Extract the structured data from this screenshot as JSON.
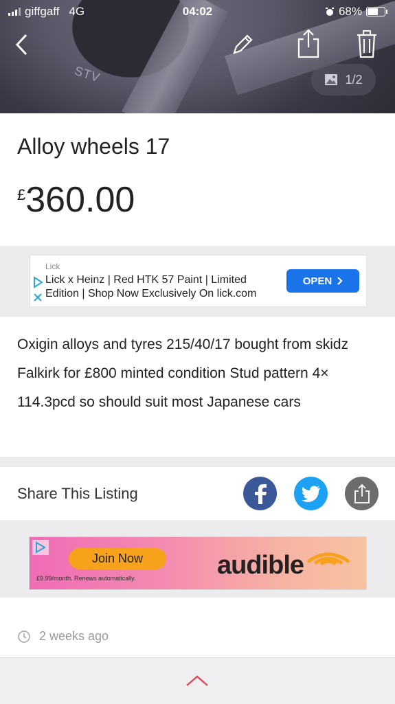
{
  "status_bar": {
    "carrier": "giffgaff",
    "network": "4G",
    "time": "04:02",
    "battery": "68%",
    "battery_level": 0.68
  },
  "header": {
    "photo_counter": "1/2",
    "rim_text": "STV"
  },
  "listing": {
    "title": "Alloy wheels 17",
    "currency": "£",
    "price": "360.00",
    "description": "Oxigin alloys and tyres 215/40/17 bought from skidz Falkirk for £800 minted condition Stud pattern 4× 114.3pcd so should suit most Japanese cars",
    "posted": "2 weeks ago"
  },
  "ad_top": {
    "brand": "Lick",
    "text": "Lick x Heinz | Red HTK 57 Paint | Limited Edition | Shop Now Exclusively On lick.com",
    "cta": "OPEN"
  },
  "share": {
    "label": "Share This Listing"
  },
  "ad_bottom": {
    "cta": "Join Now",
    "fine_print": "£9.99/month. Renews automatically.",
    "brand": "audible"
  },
  "colors": {
    "facebook": "#3b5998",
    "twitter": "#1da1f2",
    "share_generic": "#6d6d6d",
    "ad_open": "#1a73e8",
    "chevron_up": "#e04a5a"
  },
  "icons": [
    "back-icon",
    "edit-icon",
    "share-icon",
    "trash-icon",
    "image-icon",
    "facebook-icon",
    "twitter-icon",
    "clock-icon",
    "chevron-up-icon"
  ]
}
